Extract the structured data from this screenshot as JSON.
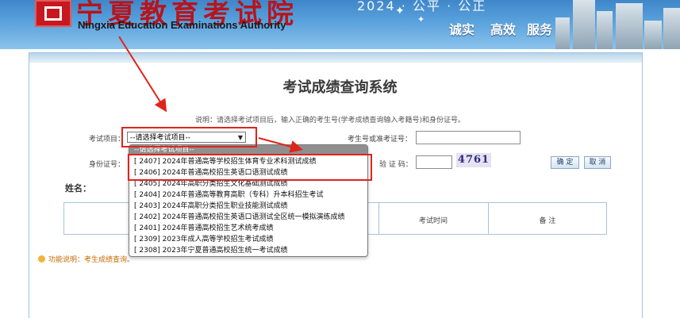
{
  "banner": {
    "org_cn": "宁夏教育考试院",
    "org_en": "Ningxia Education Examinations Authority",
    "year_strip": "2024 · 公平 · 公正",
    "slogans": [
      "诚实",
      "高效",
      "服务"
    ]
  },
  "page": {
    "title": "考试成绩查询系统",
    "instruction": "说明：请选择考试项目后，输入正确的考生号(学考成绩查询输入考籍号)和身份证号。"
  },
  "form": {
    "exam_label": "考试项目：",
    "exam_selected": "--请选择考试项目--",
    "exam_options": [
      "--请选择考试项目--",
      "[ 2407] 2024年普通高等学校招生体育专业术科测试成绩",
      "[ 2406] 2024年普通高校招生英语口语测试成绩",
      "[ 2405] 2024年高职分类招生文化基础测试成绩",
      "[ 2404] 2024年普通高等教育高职（专科）升本科招生考试",
      "[ 2403] 2024年高职分类招生职业技能测试成绩",
      "[ 2402] 2024年普通高校招生英语口语测试全区统一模拟演练成绩",
      "[ 2401] 2024年普通高校招生艺术统考成绩",
      "[ 2309] 2023年成人高等学校招生考试成绩",
      "[ 2308] 2023年宁夏普通高校招生统一考试成绩"
    ],
    "candidate_label": "考生号或准考证号：",
    "candidate_value": "",
    "id_label": "身份证号：",
    "id_value": "",
    "captcha_label": "验 证 码：",
    "captcha_value": "",
    "captcha_image_text": "4761",
    "confirm_button": "确 定",
    "cancel_button": "取 消"
  },
  "result": {
    "name_label": "姓名：",
    "columns": [
      "",
      "",
      "考试时间",
      "备 注"
    ]
  },
  "footer": {
    "function_note": "功能说明：考生成绩查询。"
  },
  "colors": {
    "banner_top": "#3e86c9",
    "annotation_red": "#e0241b",
    "org_red": "#b8141c",
    "selected_option": "#8f8f8f"
  }
}
